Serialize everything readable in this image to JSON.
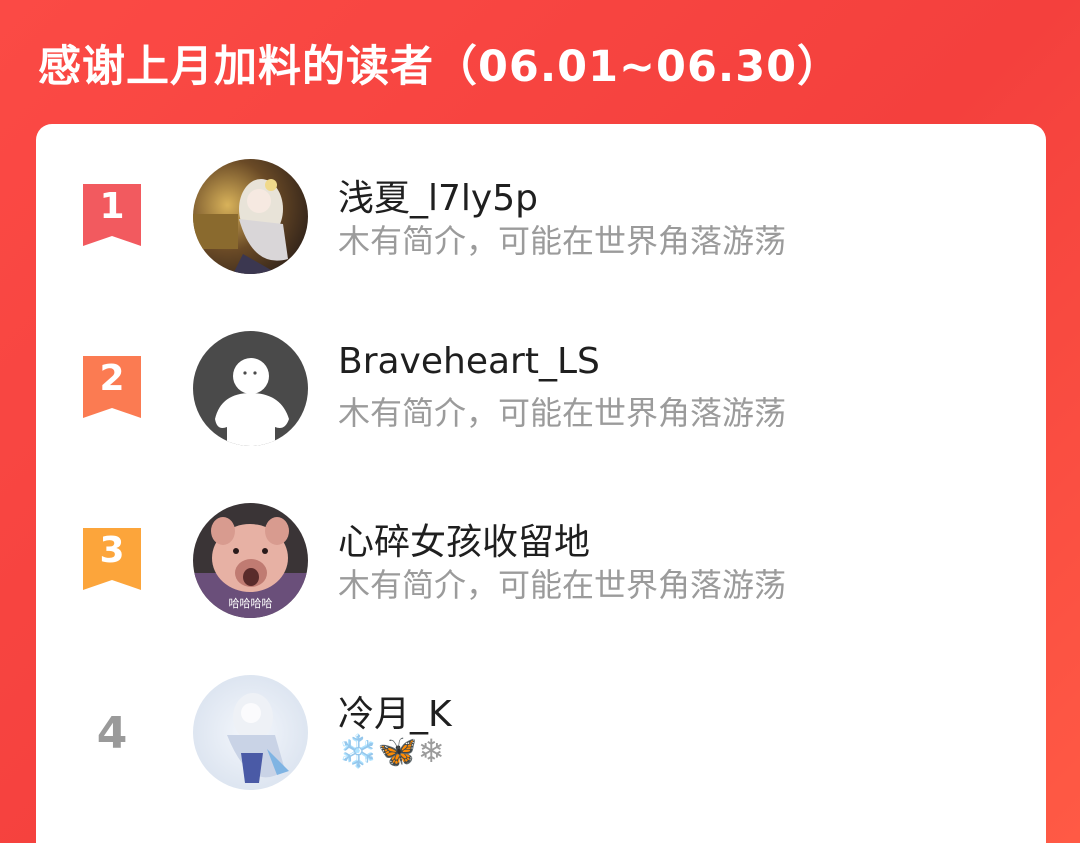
{
  "header": {
    "title": "感谢上月加料的读者（06.01~06.30）"
  },
  "leaderboard": [
    {
      "rank": "1",
      "name": "浅夏_l7ly5p",
      "bio": "木有简介，可能在世界角落游荡",
      "badge_color": "#f25a5f"
    },
    {
      "rank": "2",
      "name": "Braveheart_LS",
      "bio": "木有简介，可能在世界角落游荡",
      "badge_color": "#fb7b52"
    },
    {
      "rank": "3",
      "name": "心碎女孩收留地",
      "bio": "木有简介，可能在世界角落游荡",
      "badge_color": "#fca53b"
    },
    {
      "rank": "4",
      "name": "冷月_K",
      "bio": "❄️🦋❄",
      "badge_color": ""
    }
  ],
  "avatars": {
    "row3_caption": "哈哈哈哈"
  },
  "colors": {
    "background": "#f4403d",
    "card": "#ffffff",
    "name_text": "#1f1f1f",
    "bio_text": "#9b9b9b",
    "rank_plain": "#9a9a9a"
  }
}
